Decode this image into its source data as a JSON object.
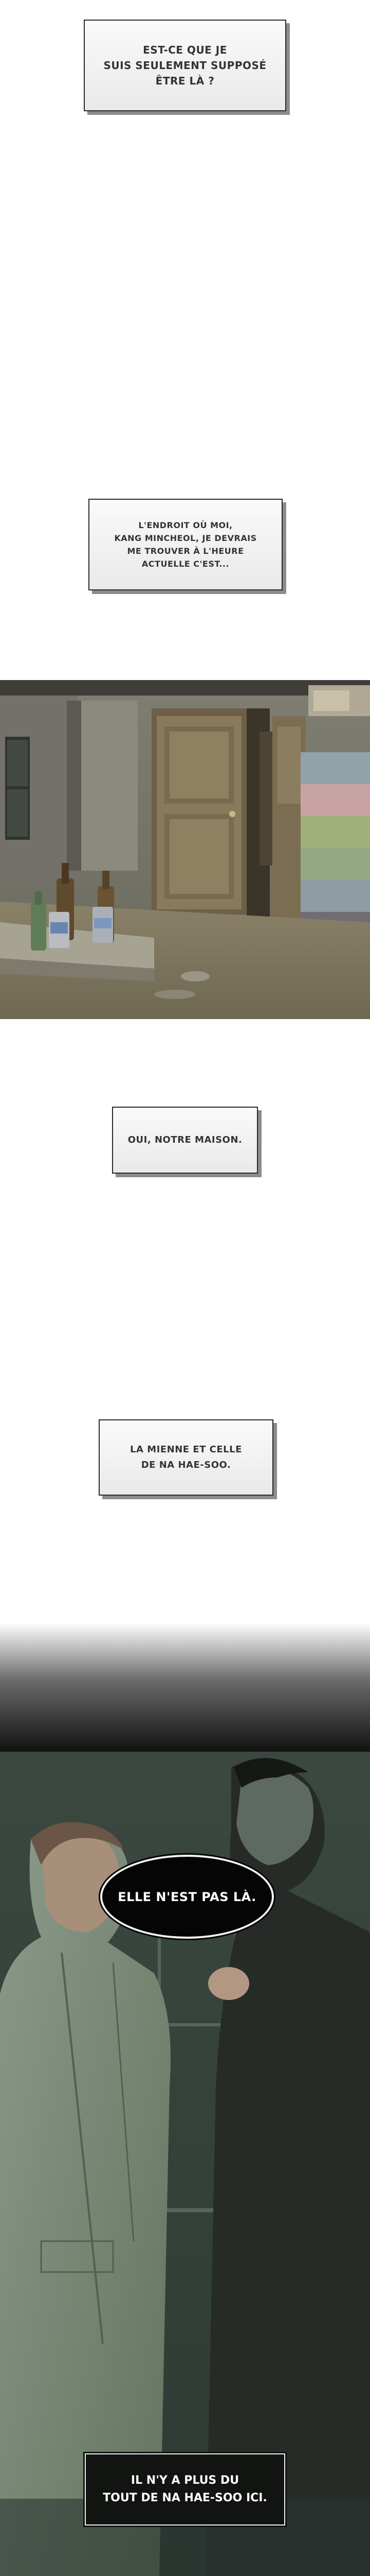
{
  "captions": {
    "c1": "EST-CE QUE JE\nSUIS SEULEMENT SUPPOSÉ\nÊTRE LÀ ?",
    "c2": "L'ENDROIT OÙ MOI,\nKANG MINCHEOL, JE DEVRAIS\nME TROUVER À L'HEURE\nACTUELLE C'EST...",
    "c3": "OUI, NOTRE MAISON.",
    "c4": "LA MIENNE ET CELLE\nDE NA HAE-SOO.",
    "bubble": "ELLE N'EST PAS LÀ.",
    "c5": "IL N'Y A PLUS DU\nTOUT DE NA HAE-SOO ICI."
  },
  "colors": {
    "panel_bg": "#ffffff",
    "caption_border": "#2a2a2a",
    "caption_shadow": "#8c8c8c",
    "night_tint": "#3d4a41"
  }
}
